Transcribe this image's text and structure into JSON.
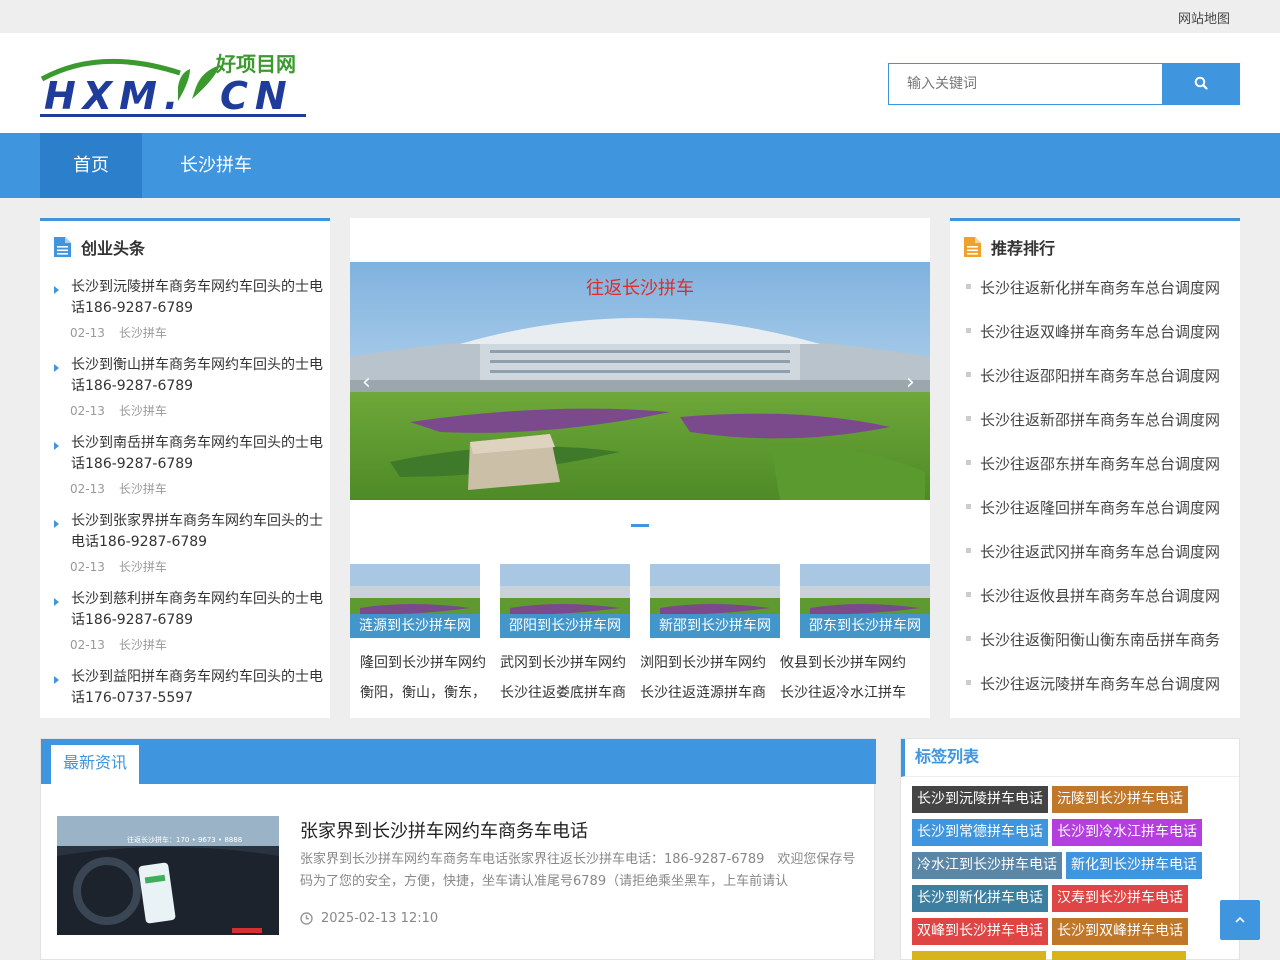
{
  "topbar": {
    "sitemap": "网站地图"
  },
  "logo": {
    "cn": "好项目网",
    "en": "HXM.CN"
  },
  "search": {
    "placeholder": "输入关键词",
    "icon": "search-icon"
  },
  "nav": {
    "items": [
      {
        "label": "首页",
        "active": true
      },
      {
        "label": "长沙拼车",
        "active": false
      }
    ]
  },
  "left": {
    "title": "创业头条",
    "items": [
      {
        "title": "长沙到沅陵拼车商务车网约车回头的士电话186-9287-6789",
        "date": "02-13",
        "cat": "长沙拼车"
      },
      {
        "title": "长沙到衡山拼车商务车网约车回头的士电话186-9287-6789",
        "date": "02-13",
        "cat": "长沙拼车"
      },
      {
        "title": "长沙到南岳拼车商务车网约车回头的士电话186-9287-6789",
        "date": "02-13",
        "cat": "长沙拼车"
      },
      {
        "title": "长沙到张家界拼车商务车网约车回头的士电话186-9287-6789",
        "date": "02-13",
        "cat": "长沙拼车"
      },
      {
        "title": "长沙到慈利拼车商务车网约车回头的士电话186-9287-6789",
        "date": "02-13",
        "cat": "长沙拼车"
      },
      {
        "title": "长沙到益阳拼车商务车网约车回头的士电话176-0737-5597",
        "date": "",
        "cat": ""
      }
    ]
  },
  "center": {
    "slide_caption": "往返长沙拼车",
    "thumbs": [
      "涟源到长沙拼车网",
      "邵阳到长沙拼车网",
      "新邵到长沙拼车网",
      "邵东到长沙拼车网"
    ],
    "links_row1": [
      "隆回到长沙拼车网约",
      "武冈到长沙拼车网约",
      "浏阳到长沙拼车网约",
      "攸县到长沙拼车网约"
    ],
    "links_row2": [
      "衡阳，衡山，衡东，",
      "长沙往返娄底拼车商",
      "长沙往返涟源拼车商",
      "长沙往返冷水江拼车"
    ]
  },
  "right": {
    "title": "推荐排行",
    "items": [
      "长沙往返新化拼车商务车总台调度网",
      "长沙往返双峰拼车商务车总台调度网",
      "长沙往返邵阳拼车商务车总台调度网",
      "长沙往返新邵拼车商务车总台调度网",
      "长沙往返邵东拼车商务车总台调度网",
      "长沙往返隆回拼车商务车总台调度网",
      "长沙往返武冈拼车商务车总台调度网",
      "长沙往返攸县拼车商务车总台调度网",
      "长沙往返衡阳衡山衡东南岳拼车商务",
      "长沙往返沅陵拼车商务车总台调度网"
    ]
  },
  "latest": {
    "tab": "最新资讯",
    "image_text": "往返长沙拼车：170 • 9673 • 8888",
    "article": {
      "title": "张家界到长沙拼车网约车商务车电话",
      "desc": "张家界到长沙拼车网约车商务车电话张家界往返长沙拼车电话：186-9287-6789　欢迎您保存号码为了您的安全，方便，快捷，坐车请认准尾号6789（请拒绝乘坐黑车，上车前请认",
      "time": "2025-02-13 12:10"
    }
  },
  "tags": {
    "title": "标签列表",
    "items": [
      {
        "label": "长沙到沅陵拼车电话",
        "color": "#444444"
      },
      {
        "label": "沅陵到长沙拼车电话",
        "color": "#c0772a"
      },
      {
        "label": "长沙到常德拼车电话",
        "color": "#3f95de"
      },
      {
        "label": "长沙到冷水江拼车电话",
        "color": "#b43ee0"
      },
      {
        "label": "冷水江到长沙拼车电话",
        "color": "#5a86a8"
      },
      {
        "label": "新化到长沙拼车电话",
        "color": "#3f95de"
      },
      {
        "label": "长沙到新化拼车电话",
        "color": "#3d7fa0"
      },
      {
        "label": "汉寿到长沙拼车电话",
        "color": "#e04545"
      },
      {
        "label": "双峰到长沙拼车电话",
        "color": "#e04545"
      },
      {
        "label": "长沙到双峰拼车电话",
        "color": "#c0772a"
      },
      {
        "label": "",
        "color": "#d8b41c"
      },
      {
        "label": "",
        "color": "#d8b41c"
      }
    ]
  }
}
